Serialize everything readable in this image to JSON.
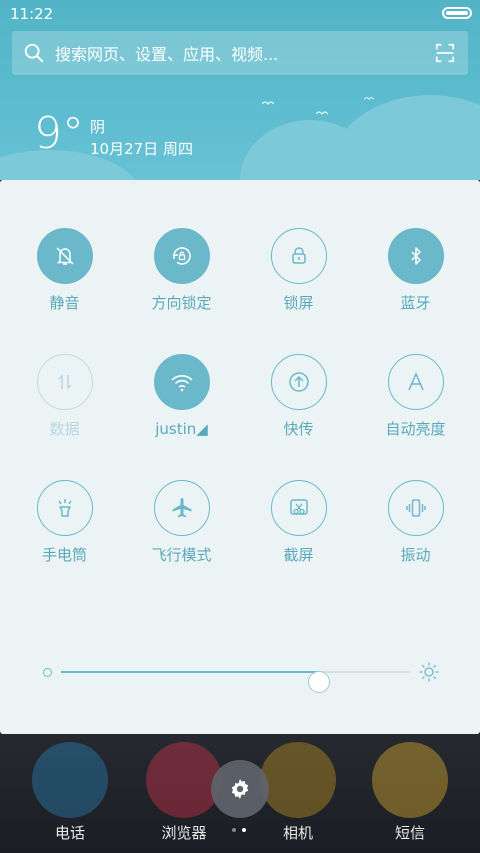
{
  "status_bar": {
    "time": "11:22"
  },
  "search": {
    "placeholder": "搜索网页、设置、应用、视频..."
  },
  "weather": {
    "temperature": "9°",
    "condition": "阴",
    "date": "10月27日 周四"
  },
  "toggles": [
    {
      "label": "静音",
      "icon": "bell-muted-icon",
      "state": "on"
    },
    {
      "label": "方向锁定",
      "icon": "rotation-lock-icon",
      "state": "on"
    },
    {
      "label": "锁屏",
      "icon": "lock-icon",
      "state": "off"
    },
    {
      "label": "蓝牙",
      "icon": "bluetooth-icon",
      "state": "on"
    },
    {
      "label": "数据",
      "icon": "mobile-data-icon",
      "state": "disabled"
    },
    {
      "label": "justin◢",
      "icon": "wifi-icon",
      "state": "on"
    },
    {
      "label": "快传",
      "icon": "quick-transfer-icon",
      "state": "off"
    },
    {
      "label": "自动亮度",
      "icon": "auto-brightness-icon",
      "state": "off"
    },
    {
      "label": "手电筒",
      "icon": "flashlight-icon",
      "state": "off"
    },
    {
      "label": "飞行模式",
      "icon": "airplane-icon",
      "state": "off"
    },
    {
      "label": "截屏",
      "icon": "screenshot-icon",
      "state": "off"
    },
    {
      "label": "振动",
      "icon": "vibrate-icon",
      "state": "off"
    }
  ],
  "brightness": {
    "level": 0.74
  },
  "dock": {
    "apps": [
      {
        "label": "电话",
        "icon": "phone-app-icon",
        "color": "#2a7db0"
      },
      {
        "label": "浏览器",
        "icon": "browser-app-icon",
        "color": "#c9314a"
      },
      {
        "label": "相机",
        "icon": "camera-app-icon",
        "color": "#b68c22"
      },
      {
        "label": "短信",
        "icon": "messages-app-icon",
        "color": "#d4a630"
      }
    ]
  },
  "colors": {
    "accent": "#6ab8c9",
    "header": "#5dbcd0",
    "panel": "#ecf3f5"
  }
}
